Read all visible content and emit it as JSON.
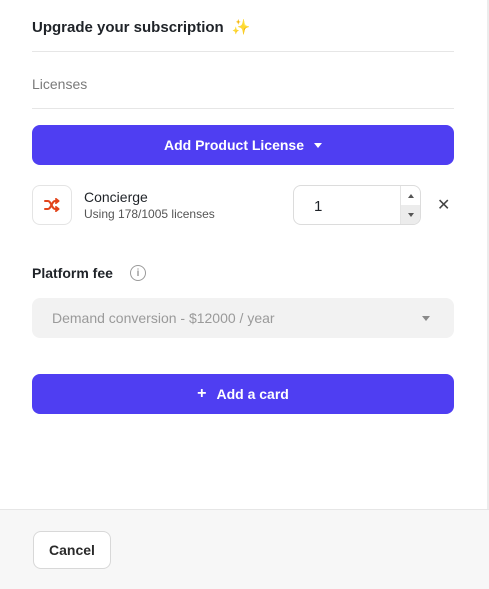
{
  "header": {
    "title": "Upgrade your subscription",
    "title_emoji": "✨"
  },
  "licenses": {
    "section_label": "Licenses",
    "add_button_label": "Add Product License",
    "items": [
      {
        "name": "Concierge",
        "usage": "Using 178/1005 licenses",
        "quantity": "1",
        "icon": "shuffle-icon",
        "icon_color": "#e2441b"
      }
    ]
  },
  "platform_fee": {
    "label": "Platform fee",
    "selected": "Demand conversion - $12000 / year"
  },
  "add_card_button_label": "Add a card",
  "footer": {
    "cancel_label": "Cancel"
  },
  "colors": {
    "accent": "#4f3ef2"
  }
}
